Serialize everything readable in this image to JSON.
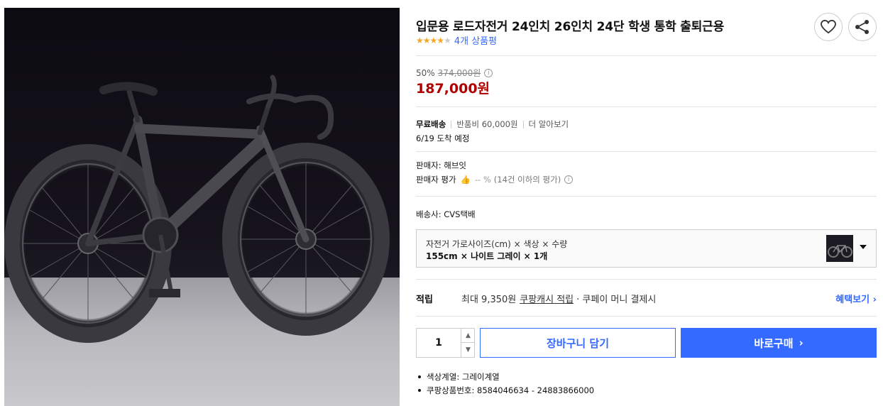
{
  "product": {
    "title": "입문용 로드자전거 24인치 26인치 24단 학생 통학 출퇴근용",
    "rating_stars": 4,
    "rating_max": 5,
    "review_count_label": "4개 상품평",
    "image_icon": "bicycle-photo"
  },
  "actions": {
    "wishlist_icon": "heart-icon",
    "share_icon": "share-icon"
  },
  "price": {
    "discount_rate": "50%",
    "original_price": "374,000원",
    "sale_price": "187,000원",
    "sale_color": "#ae0000"
  },
  "shipping": {
    "free_label": "무료배송",
    "return_fee": "반품비 60,000원",
    "more_link": "더 알아보기",
    "arrival": "6/19 도착 예정"
  },
  "seller": {
    "name_label": "판매자: 해브잇",
    "rating_label": "판매자 평가",
    "rating_value": "-- %",
    "rating_note": "(14건 이하의 평가)"
  },
  "carrier": {
    "label": "배송사: CVS택배"
  },
  "option": {
    "label": "자전거 가로사이즈(cm) × 색상 × 수량",
    "value": "155cm × 나이트 그레이 × 1개"
  },
  "reward": {
    "label": "적립",
    "prefix": "최대 9,350원",
    "link": "쿠팡캐시 적립",
    "suffix": "· 쿠페이 머니 결제시",
    "benefit_link": "혜택보기 ›"
  },
  "purchase": {
    "quantity": "1",
    "cart_label": "장바구니 담기",
    "buy_label": "바로구매",
    "buy_chevron": "›",
    "accent": "#346aff"
  },
  "specs": [
    "색상계열: 그레이계열",
    "쿠팡상품번호: 8584046634 - 24883866000"
  ]
}
